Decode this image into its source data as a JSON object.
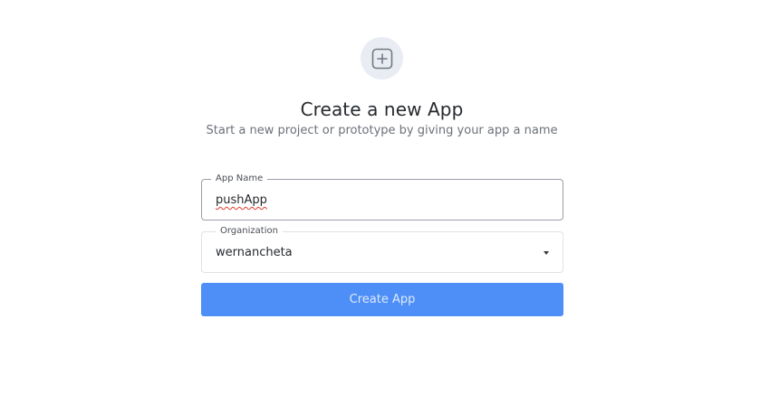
{
  "header": {
    "icon": "plus-square-icon",
    "title": "Create a new App",
    "subtitle": "Start a new project or prototype by giving your app a name"
  },
  "form": {
    "app_name": {
      "label": "App Name",
      "value": "pushApp"
    },
    "organization": {
      "label": "Organization",
      "value": "wernancheta",
      "icon": "caret-down-icon"
    },
    "submit_label": "Create App"
  },
  "colors": {
    "accent": "#4d8ff7",
    "icon_circle_bg": "#e9edf3",
    "icon_stroke": "#6f7885"
  }
}
